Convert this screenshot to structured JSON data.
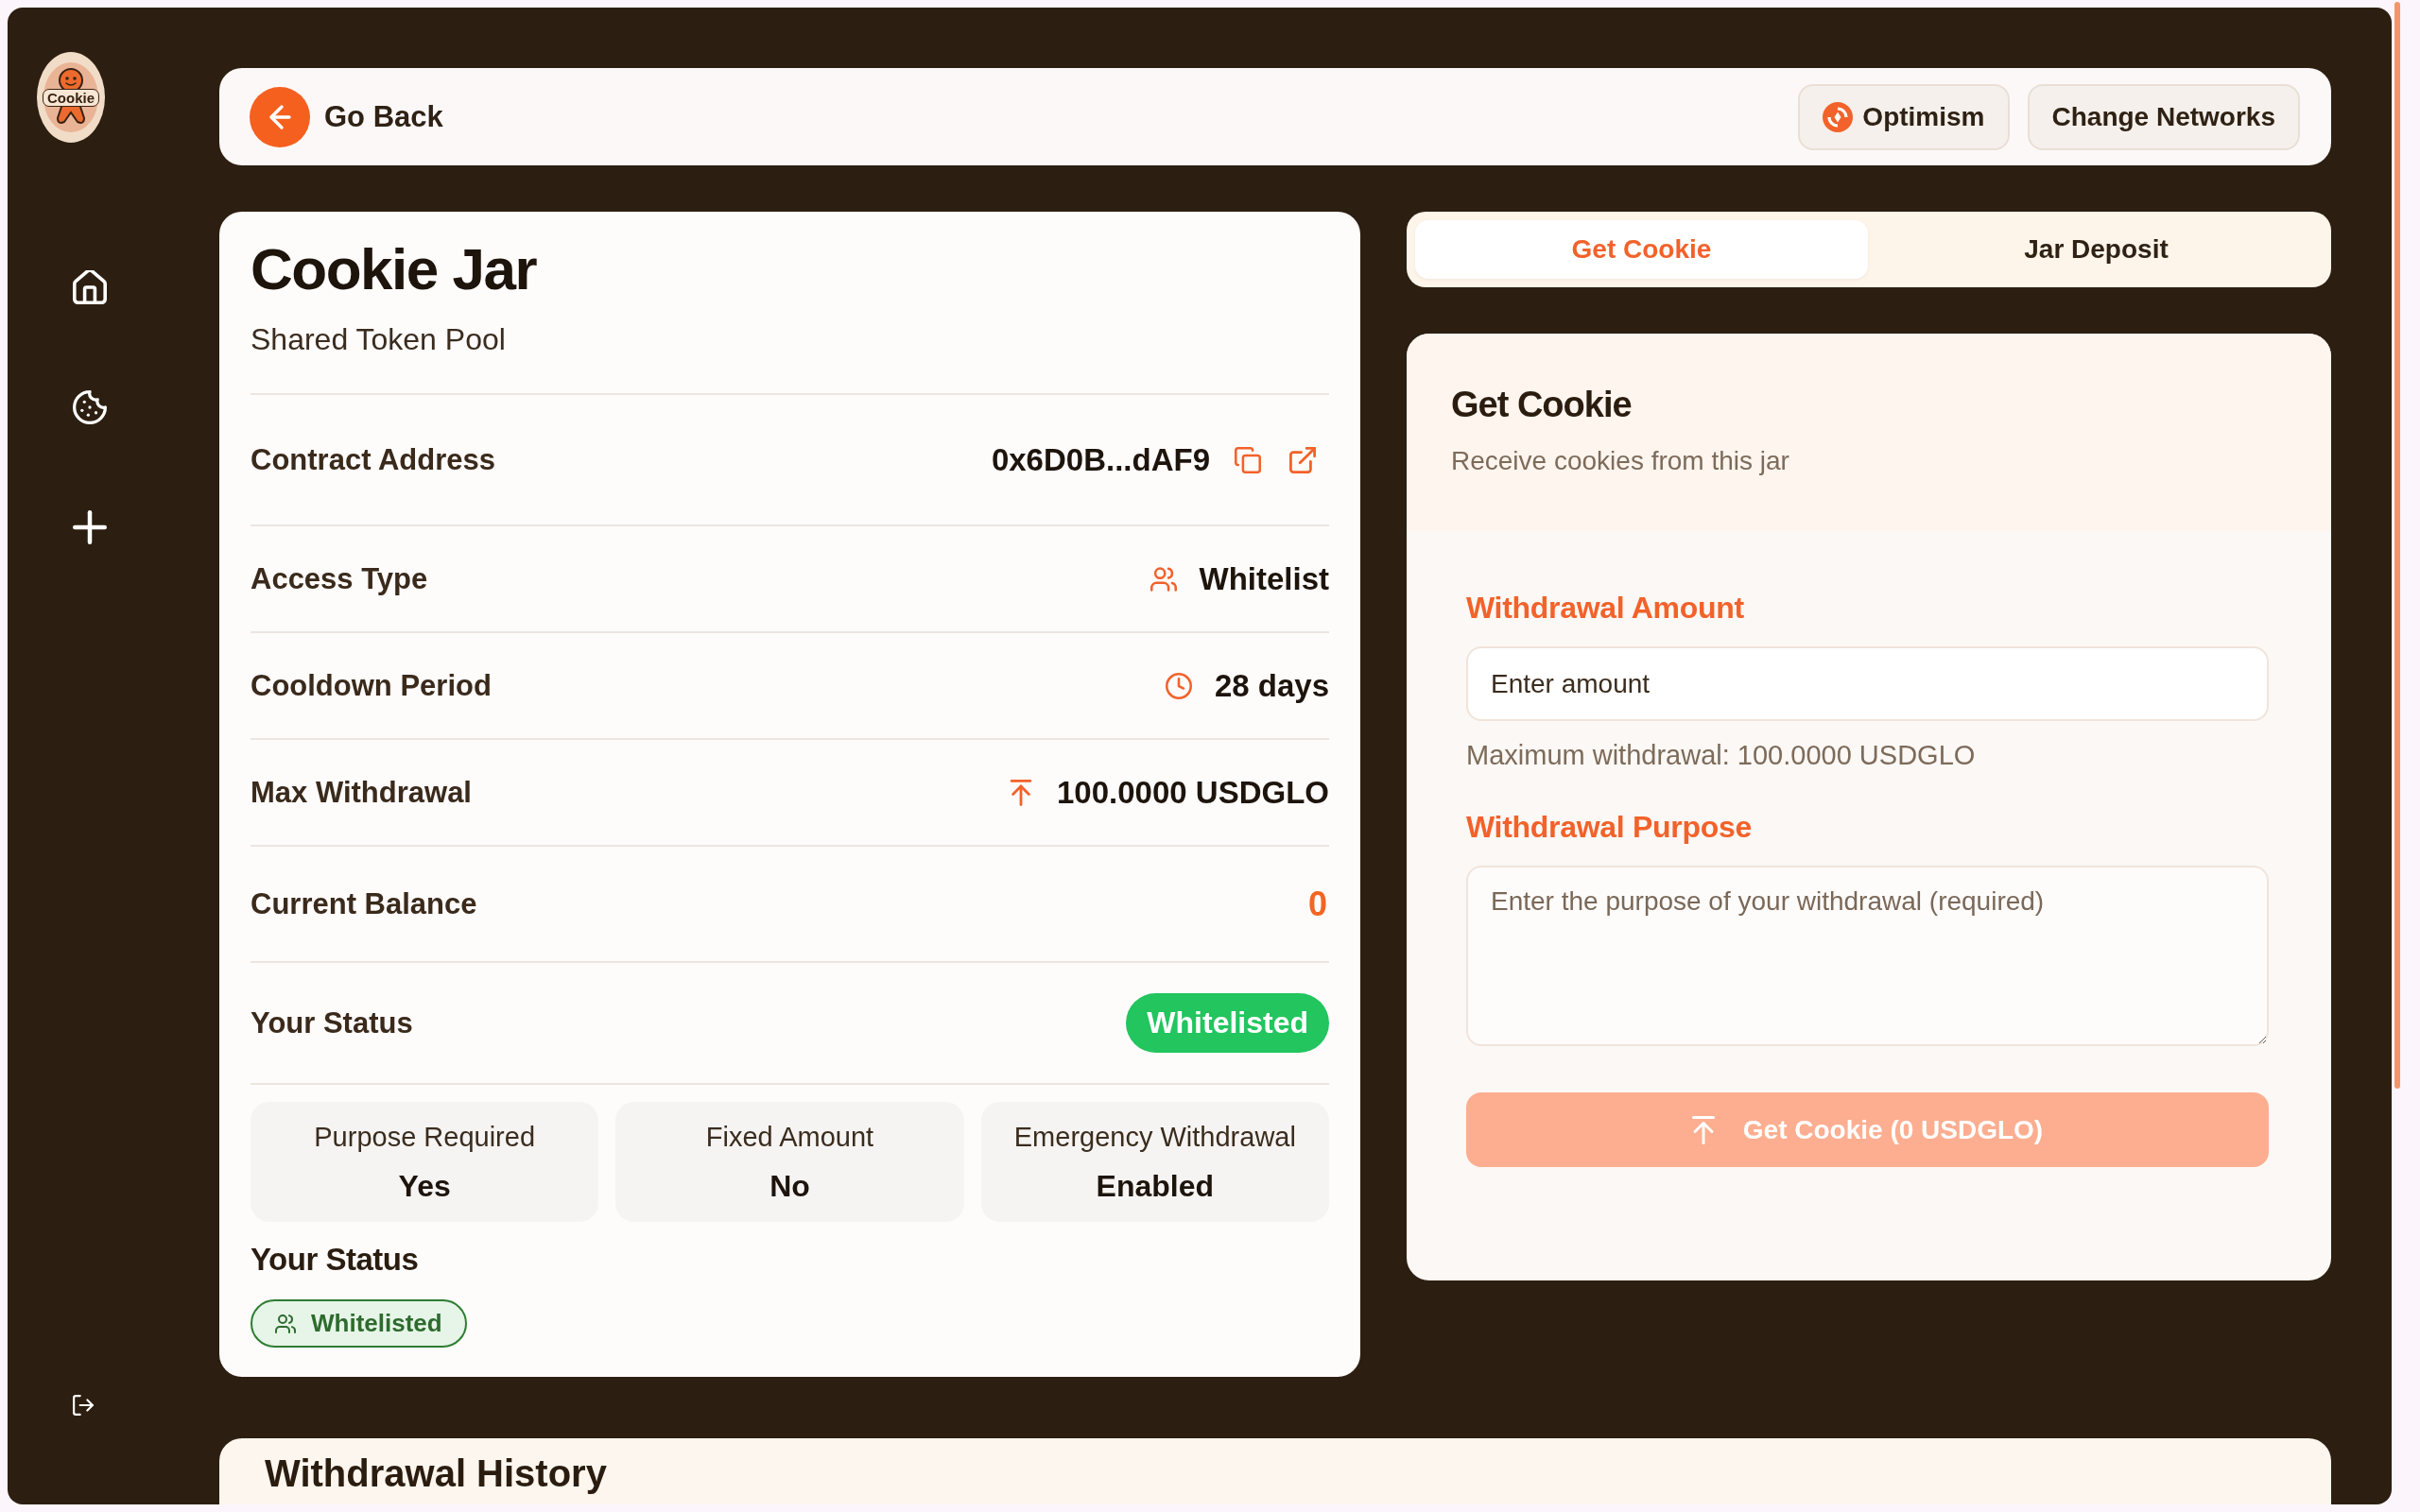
{
  "logo": {
    "text": "Cookie"
  },
  "top_bar": {
    "back_button": "Go Back",
    "network_button": "Optimism",
    "change_networks_button": "Change Networks"
  },
  "jar": {
    "title": "Cookie Jar",
    "subtitle": "Shared Token Pool",
    "details": [
      {
        "kind": "address",
        "label": "Contract Address",
        "value": "0x6D0B...dAF9"
      },
      {
        "kind": "access",
        "label": "Access Type",
        "value": "Whitelist"
      },
      {
        "kind": "cooldown",
        "label": "Cooldown Period",
        "value": "28 days"
      },
      {
        "kind": "max",
        "label": "Max Withdrawal",
        "value": "100.0000 USDGLO"
      },
      {
        "kind": "balance",
        "label": "Current Balance",
        "value": "0"
      },
      {
        "kind": "status",
        "label": "Your Status",
        "value": "Whitelisted"
      }
    ],
    "features": [
      {
        "label": "Purpose Required",
        "value": "Yes"
      },
      {
        "label": "Fixed Amount",
        "value": "No"
      },
      {
        "label": "Emergency Withdrawal",
        "value": "Enabled"
      }
    ],
    "status_section": {
      "heading": "Your Status",
      "badge": "Whitelisted"
    }
  },
  "tabs": [
    {
      "label": "Get Cookie",
      "selected": true
    },
    {
      "label": "Jar Deposit",
      "selected": false
    }
  ],
  "get_cookie": {
    "title": "Get Cookie",
    "subtitle": "Receive cookies from this jar",
    "amount": {
      "label": "Withdrawal Amount",
      "placeholder": "Enter amount"
    },
    "helper": "Maximum withdrawal: 100.0000 USDGLO",
    "purpose": {
      "label": "Withdrawal Purpose",
      "placeholder": "Enter the purpose of your withdrawal (required)"
    },
    "submit": {
      "label": "Get Cookie (0 USDGLO)",
      "disabled": true
    }
  },
  "history": {
    "title": "Withdrawal History"
  }
}
